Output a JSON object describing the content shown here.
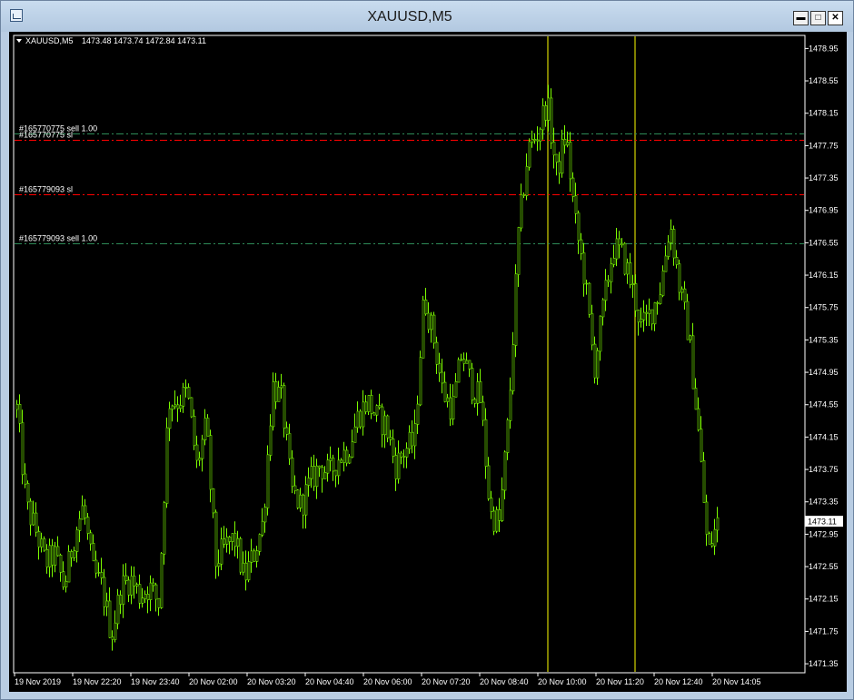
{
  "window": {
    "title": "XAUUSD,M5",
    "minimize_label": "▬",
    "maximize_label": "□",
    "close_label": "✕"
  },
  "chart_info": {
    "symbol": "XAUUSD,M5",
    "ohlc": "1473.48 1473.74 1472.84 1473.11"
  },
  "colors": {
    "background": "#000000",
    "candle": "#7cfc00",
    "sell_line": "#2e8b57",
    "sl_line": "#ff0000",
    "vline": "#ffff00",
    "text": "#ffffff"
  },
  "current_price": "1473.11",
  "orders": [
    {
      "label": "#165770775 sell 1.00",
      "price": 1477.9,
      "kind": "sell"
    },
    {
      "label": "#165770775 sl",
      "price": 1477.82,
      "kind": "sl"
    },
    {
      "label": "#165779093 sl",
      "price": 1477.15,
      "kind": "sl"
    },
    {
      "label": "#165779093 sell 1.00",
      "price": 1476.54,
      "kind": "sell"
    }
  ],
  "chart_data": {
    "type": "line",
    "symbol": "XAUUSD",
    "timeframe": "M5",
    "ylim": [
      1471.25,
      1479.1
    ],
    "y_ticks": [
      "1478.95",
      "1478.55",
      "1478.15",
      "1477.75",
      "1477.35",
      "1476.95",
      "1476.55",
      "1476.15",
      "1475.75",
      "1475.35",
      "1474.95",
      "1474.55",
      "1474.15",
      "1473.75",
      "1473.35",
      "1472.95",
      "1472.55",
      "1472.15",
      "1471.75",
      "1471.35"
    ],
    "x_ticks": [
      "19 Nov 2019",
      "19 Nov 22:20",
      "19 Nov 23:40",
      "20 Nov 02:00",
      "20 Nov 03:20",
      "20 Nov 04:40",
      "20 Nov 06:00",
      "20 Nov 07:20",
      "20 Nov 08:40",
      "20 Nov 10:00",
      "20 Nov 11:20",
      "20 Nov 12:40",
      "20 Nov 14:05"
    ],
    "vertical_markers": [
      "20 Nov 10:00",
      "20 Nov 11:20"
    ],
    "close_path": [
      1474.5,
      1473.3,
      1473.0,
      1472.6,
      1472.7,
      1472.3,
      1472.9,
      1473.3,
      1472.5,
      1472.3,
      1471.7,
      1472.3,
      1472.4,
      1472.2,
      1472.3,
      1472.1,
      1474.6,
      1474.6,
      1474.7,
      1473.8,
      1474.3,
      1472.6,
      1472.8,
      1472.9,
      1472.4,
      1472.7,
      1473.1,
      1474.8,
      1474.6,
      1473.5,
      1473.3,
      1473.6,
      1473.8,
      1473.7,
      1473.9,
      1474.0,
      1474.4,
      1474.6,
      1474.4,
      1474.3,
      1473.8,
      1474.0,
      1474.1,
      1475.9,
      1475.4,
      1474.7,
      1474.5,
      1475.2,
      1474.8,
      1474.6,
      1473.2,
      1473.1,
      1474.5,
      1476.7,
      1477.7,
      1477.9,
      1478.3,
      1477.4,
      1477.9,
      1476.8,
      1476.1,
      1475.0,
      1475.8,
      1476.5,
      1476.4,
      1476.0,
      1475.5,
      1475.7,
      1476.0,
      1476.8,
      1476.0,
      1475.4,
      1474.2,
      1472.7,
      1473.1
    ]
  }
}
